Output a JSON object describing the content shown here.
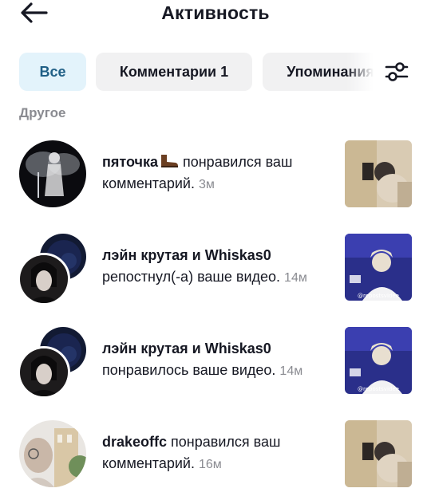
{
  "header": {
    "title": "Активность"
  },
  "tabs": [
    {
      "label": "Все",
      "active": true
    },
    {
      "label": "Комментарии 1",
      "active": false
    },
    {
      "label": "Упоминания",
      "active": false
    }
  ],
  "section": {
    "label": "Другое"
  },
  "notifications": [
    {
      "name": "пяточка",
      "emoji": "boot",
      "action": " понравился ваш комментарий.",
      "time": "3м"
    },
    {
      "name": "лэйн крутая и Whiskas0",
      "action": "репостнул(-а) ваше видео.",
      "time": "14м",
      "thumb_caption": "@repostsvidee"
    },
    {
      "name": "лэйн крутая и Whiskas0",
      "action": "понравилось ваше видео.",
      "time": "14м",
      "thumb_caption": "@repostsvidee"
    },
    {
      "name": "drakeoffc",
      "action": " понравился ваш комментарий.",
      "time": "16м"
    }
  ],
  "colors": {
    "accent_chip_bg": "#e3f3fb",
    "accent_chip_text": "#1f5f86",
    "chip_bg": "#f1f1f2",
    "muted_text": "#8a8b91"
  }
}
